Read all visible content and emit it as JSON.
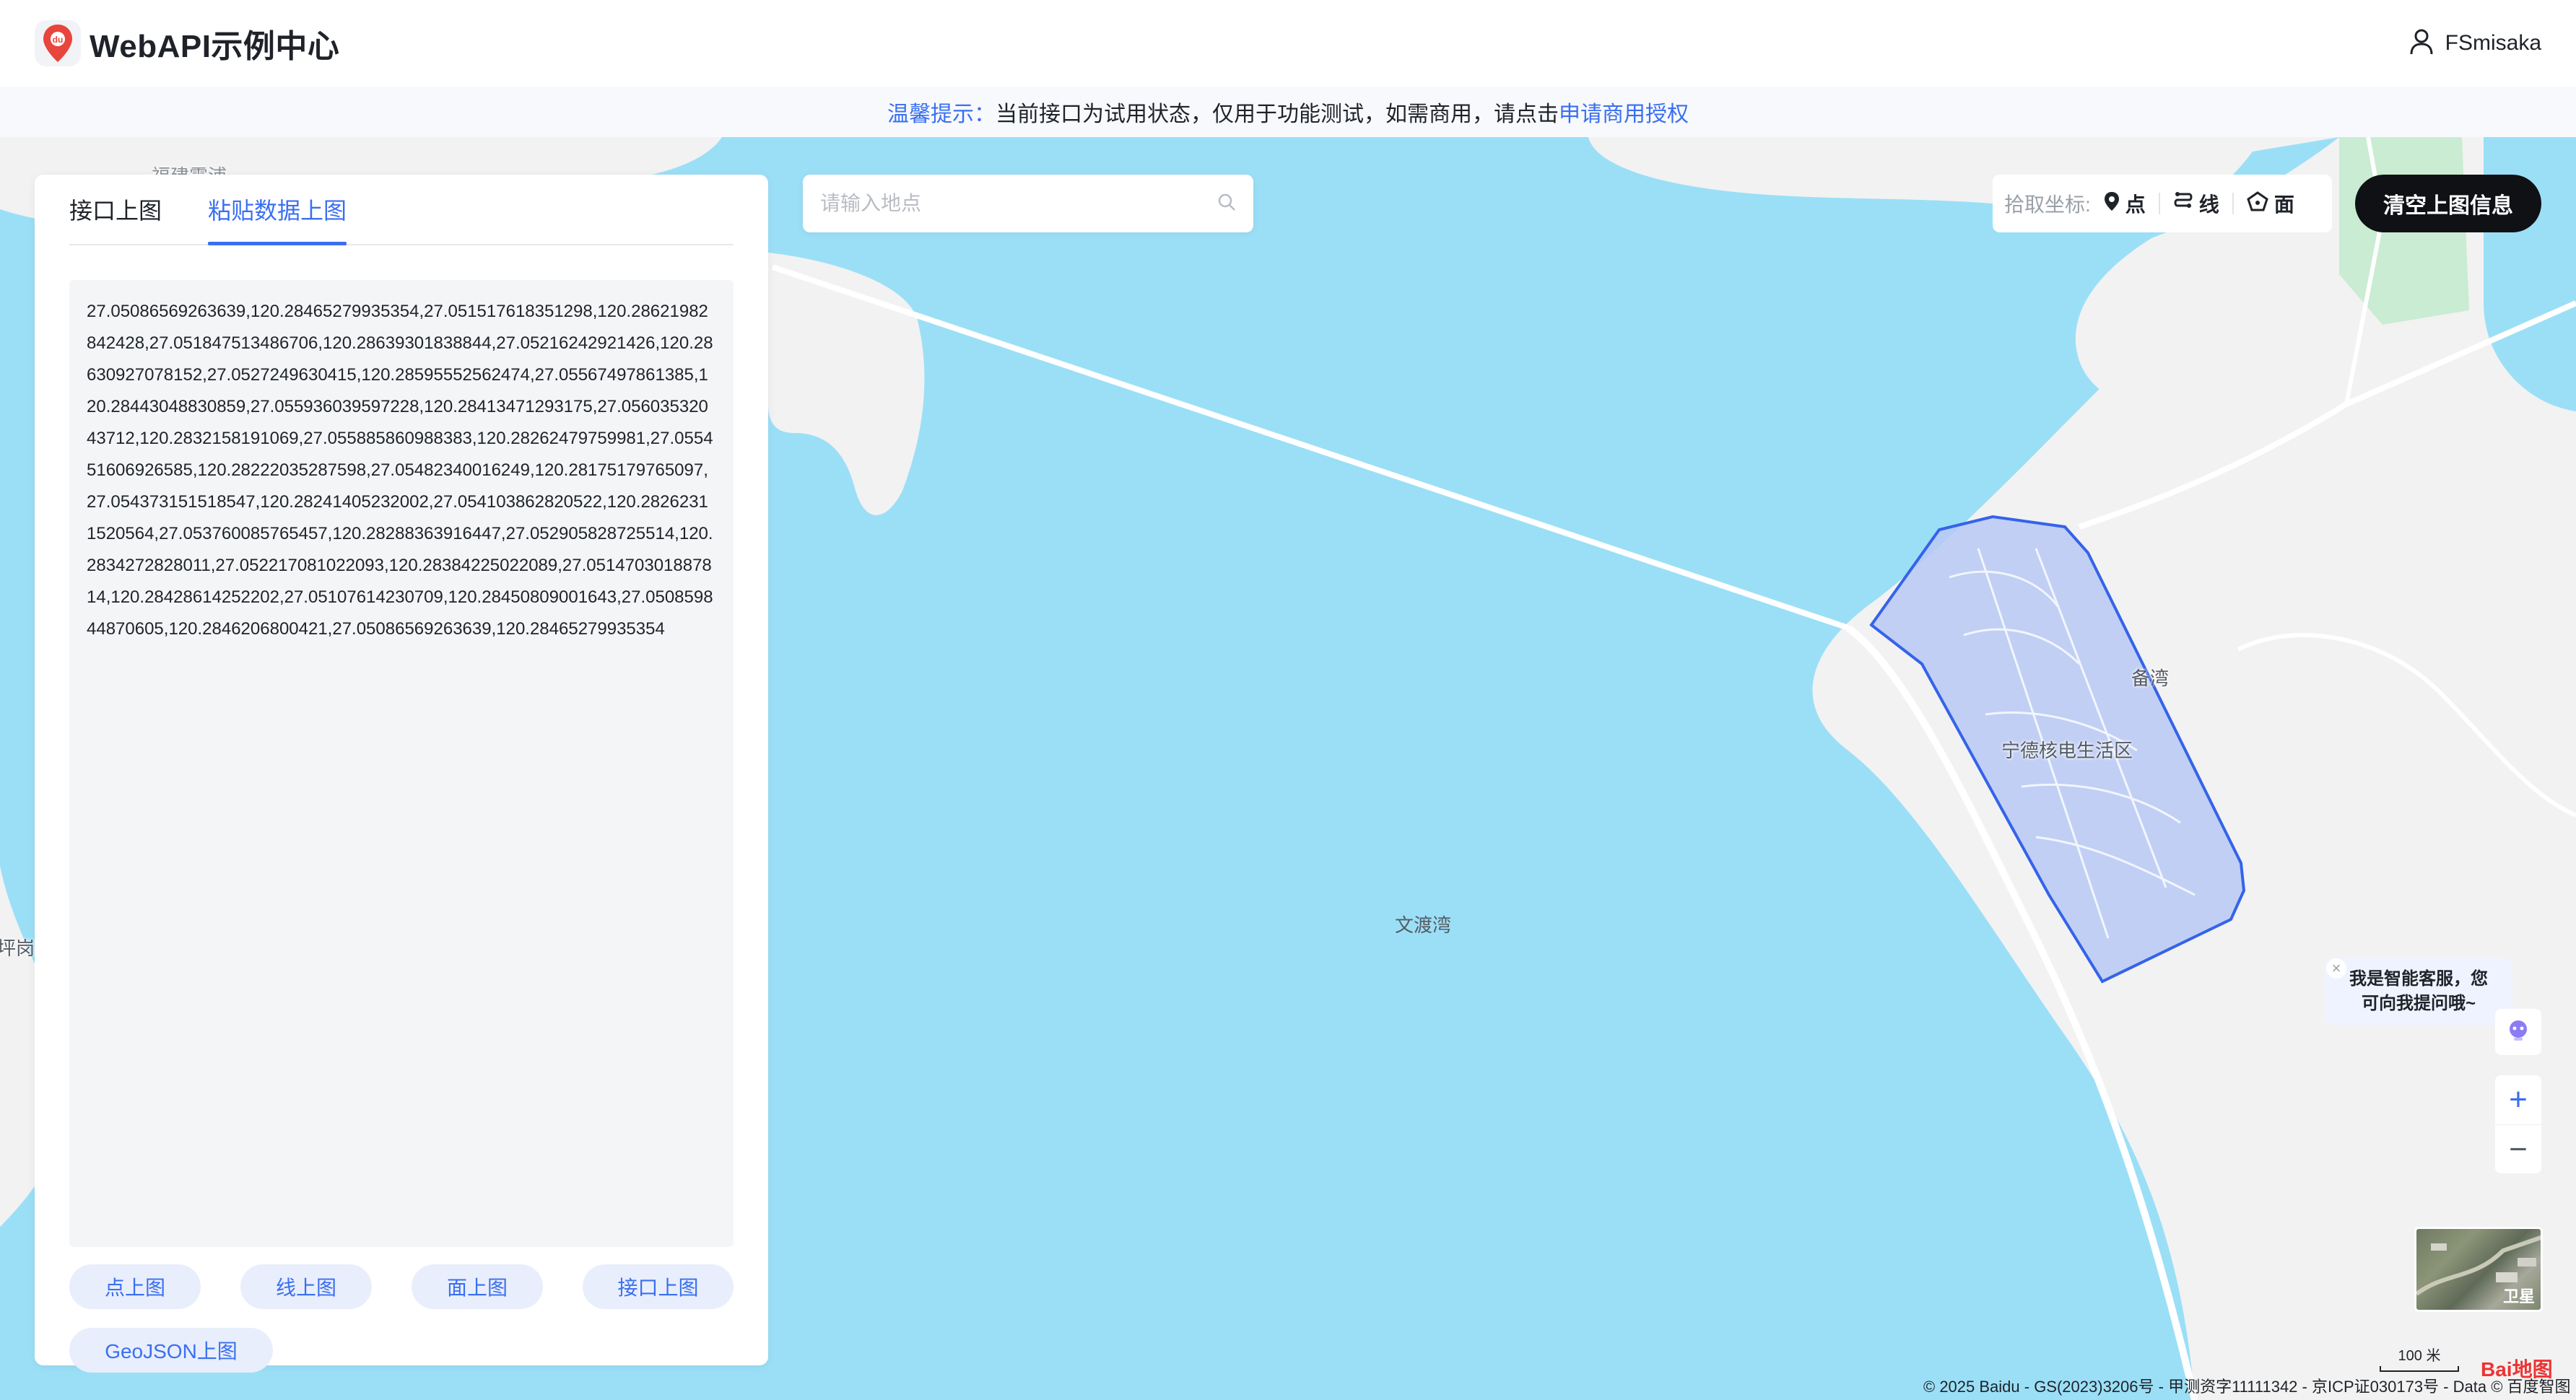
{
  "app": {
    "title": "WebAPI示例中心",
    "user_name": "FSmisaka"
  },
  "notice": {
    "prefix": "温馨提示：",
    "text": "当前接口为试用状态，仅用于功能测试，如需商用，请点击",
    "link": "申请商用授权"
  },
  "panel": {
    "tabs": [
      {
        "label": "接口上图",
        "active": false
      },
      {
        "label": "粘贴数据上图",
        "active": true
      }
    ],
    "textarea_value": "27.05086569263639,120.28465279935354,27.051517618351298,120.28621982842428,27.051847513486706,120.28639301838844,27.05216242921426,120.28630927078152,27.0527249630415,120.28595552562474,27.05567497861385,120.28443048830859,27.055936039597228,120.28413471293175,27.05603532043712,120.2832158191069,27.055885860988383,120.28262479759981,27.055451606926585,120.28222035287598,27.05482340016249,120.28175179765097,27.054373151518547,120.28241405232002,27.054103862820522,120.28262311520564,27.053760085765457,120.28288363916447,27.052905828725514,120.2834272828011,27.052217081022093,120.28384225022089,27.051470301887814,120.28428614252202,27.05107614230709,120.28450809001643,27.050859844870605,120.2846206800421,27.05086569263639,120.28465279935354",
    "buttons": [
      "点上图",
      "线上图",
      "面上图",
      "接口上图",
      "GeoJSON上图"
    ]
  },
  "search": {
    "placeholder": "请输入地点",
    "icon": "search-icon"
  },
  "coord_tool": {
    "label": "拾取坐标:",
    "items": [
      {
        "label": "点",
        "icon": "map-pin-icon"
      },
      {
        "label": "线",
        "icon": "polyline-icon"
      },
      {
        "label": "面",
        "icon": "polygon-icon"
      }
    ]
  },
  "clear_button": "清空上图信息",
  "map": {
    "labels": {
      "bay": "文渡湾",
      "area": "宁德核电生活区",
      "harbor": "备湾",
      "left_edge": "坪岗",
      "top_partial": "福建霞浦"
    },
    "scale_label": "100 米",
    "satellite_label": "卫星",
    "copyright": "© 2025 Baidu - GS(2023)3206号 - 甲测资字11111342 - 京ICP证030173号 - Data © 百度智图",
    "logo": "Bai地图",
    "colors": {
      "water": "#9bdff7",
      "land": "#f2f2f2",
      "polygon_fill": "#b9c9f6",
      "polygon_stroke": "#3563e9",
      "park": "#c9ecd2"
    }
  },
  "chat": {
    "text_line1": "我是智能客服，您",
    "text_line2": "可向我提问哦~"
  },
  "zoom": {
    "in": "+",
    "out": "−"
  }
}
